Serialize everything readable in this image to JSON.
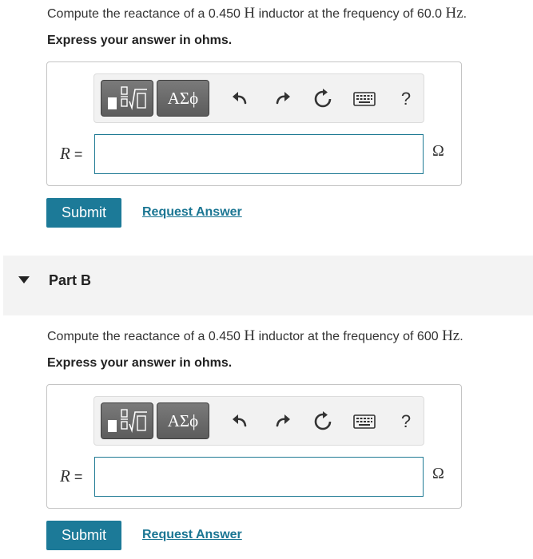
{
  "partA": {
    "prompt": {
      "pre": "Compute the reactance of a 0.450 ",
      "unit_h": "H",
      "mid": " inductor at the frequency of 60.0 ",
      "unit_hz": "Hz",
      "post": "."
    },
    "instruction": "Express your answer in ohms.",
    "toolbar": {
      "greek_label": "ΑΣϕ",
      "help_label": "?"
    },
    "answer": {
      "var": "R",
      "eq": " =",
      "value": "",
      "unit": "Ω"
    },
    "submit_label": "Submit",
    "request_label": "Request Answer"
  },
  "partB": {
    "title": "Part B",
    "prompt": {
      "pre": "Compute the reactance of a 0.450 ",
      "unit_h": "H",
      "mid": " inductor at the frequency of 600 ",
      "unit_hz": "Hz",
      "post": "."
    },
    "instruction": "Express your answer in ohms.",
    "toolbar": {
      "greek_label": "ΑΣϕ",
      "help_label": "?"
    },
    "answer": {
      "var": "R",
      "eq": " =",
      "value": "",
      "unit": "Ω"
    },
    "submit_label": "Submit",
    "request_label": "Request Answer"
  },
  "colors": {
    "accent": "#1c7a98",
    "link": "#1b7693",
    "toolbar_button": "#6b6b6b",
    "input_border": "#1f7a94"
  }
}
